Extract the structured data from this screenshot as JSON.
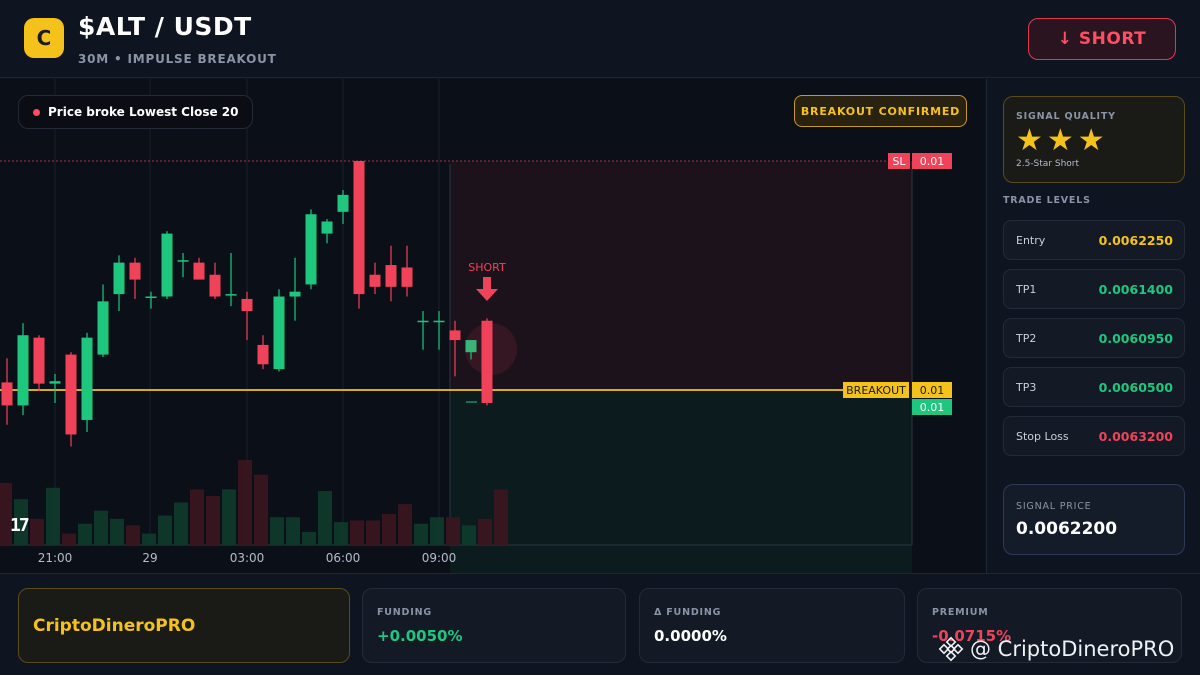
{
  "header": {
    "logo_letter": "C",
    "pair": "$ALT / USDT",
    "subtitle": "30M • IMPULSE BREAKOUT",
    "direction_button": "↓ SHORT"
  },
  "chart": {
    "signal_pill": "Price broke Lowest Close 20",
    "confirm_badge": "BREAKOUT CONFIRMED",
    "tv_logo": "17",
    "colors": {
      "up": "#1fc77e",
      "down": "#f0435a",
      "breakout": "#f5c21b"
    }
  },
  "chart_data": {
    "type": "candlestick",
    "x_ticks": [
      "21:00",
      "29",
      "03:00",
      "06:00",
      "09:00"
    ],
    "candles": [
      {
        "o": 0.0062285,
        "h": 0.0062385,
        "l": 0.006211,
        "c": 0.006219
      },
      {
        "o": 0.006219,
        "h": 0.006253,
        "l": 0.006215,
        "c": 0.006248
      },
      {
        "o": 0.006247,
        "h": 0.006248,
        "l": 0.006225,
        "c": 0.006228
      },
      {
        "o": 0.006228,
        "h": 0.006232,
        "l": 0.00622,
        "c": 0.006229
      },
      {
        "o": 0.00624,
        "h": 0.006241,
        "l": 0.006202,
        "c": 0.006207
      },
      {
        "o": 0.006213,
        "h": 0.006249,
        "l": 0.006208,
        "c": 0.006247
      },
      {
        "o": 0.00624,
        "h": 0.006269,
        "l": 0.006239,
        "c": 0.006262
      },
      {
        "o": 0.006265,
        "h": 0.006281,
        "l": 0.006258,
        "c": 0.006278
      },
      {
        "o": 0.006278,
        "h": 0.00628,
        "l": 0.006263,
        "c": 0.006271
      },
      {
        "o": 0.006264,
        "h": 0.006266,
        "l": 0.006259,
        "c": 0.006264
      },
      {
        "o": 0.006264,
        "h": 0.006291,
        "l": 0.006263,
        "c": 0.00629
      },
      {
        "o": 0.006279,
        "h": 0.006282,
        "l": 0.006272,
        "c": 0.006279
      },
      {
        "o": 0.006278,
        "h": 0.00628,
        "l": 0.006273,
        "c": 0.006271
      },
      {
        "o": 0.006273,
        "h": 0.006278,
        "l": 0.006263,
        "c": 0.006264
      },
      {
        "o": 0.006265,
        "h": 0.006282,
        "l": 0.00626,
        "c": 0.006265
      },
      {
        "o": 0.006263,
        "h": 0.006266,
        "l": 0.006246,
        "c": 0.006258
      },
      {
        "o": 0.006244,
        "h": 0.006248,
        "l": 0.006234,
        "c": 0.006236
      },
      {
        "o": 0.006234,
        "h": 0.006267,
        "l": 0.006233,
        "c": 0.006264
      },
      {
        "o": 0.006264,
        "h": 0.00628,
        "l": 0.006254,
        "c": 0.006266
      },
      {
        "o": 0.006269,
        "h": 0.0063,
        "l": 0.006267,
        "c": 0.006298
      },
      {
        "o": 0.00629,
        "h": 0.006296,
        "l": 0.006286,
        "c": 0.006295
      },
      {
        "o": 0.006299,
        "h": 0.006308,
        "l": 0.006294,
        "c": 0.006306
      },
      {
        "o": 0.00632,
        "h": 0.00632,
        "l": 0.006259,
        "c": 0.006265
      },
      {
        "o": 0.006273,
        "h": 0.006278,
        "l": 0.006265,
        "c": 0.006268
      },
      {
        "o": 0.006277,
        "h": 0.006285,
        "l": 0.006262,
        "c": 0.006268
      },
      {
        "o": 0.006276,
        "h": 0.006285,
        "l": 0.006264,
        "c": 0.006268
      },
      {
        "o": 0.006254,
        "h": 0.006258,
        "l": 0.006242,
        "c": 0.006254
      },
      {
        "o": 0.006254,
        "h": 0.006258,
        "l": 0.006242,
        "c": 0.006254
      },
      {
        "o": 0.00625,
        "h": 0.006254,
        "l": 0.006231,
        "c": 0.006246
      },
      {
        "o": 0.006241,
        "h": 0.006244,
        "l": 0.006238,
        "c": 0.006246
      },
      {
        "o": 0.006254,
        "h": 0.006255,
        "l": 0.006219,
        "c": 0.00622
      }
    ],
    "volume": [
      38,
      28,
      16,
      35,
      7,
      13,
      21,
      16,
      12,
      7,
      18,
      26,
      34,
      30,
      34,
      52,
      43,
      17,
      17,
      8,
      33,
      14,
      15,
      15,
      19,
      25,
      13,
      17,
      17,
      12,
      16,
      34
    ],
    "levels": {
      "stop_loss": {
        "label": "SL",
        "value": "0.01"
      },
      "breakout": {
        "label": "BREAKOUT",
        "value": "0.01"
      },
      "current": {
        "value": "0.01"
      }
    },
    "annotation": "SHORT"
  },
  "right_panel": {
    "quality_label": "SIGNAL QUALITY",
    "stars": "★★★",
    "quality_sub": "2.5-Star Short",
    "levels_title": "TRADE LEVELS",
    "levels": [
      {
        "name": "Entry",
        "value": "0.0062250",
        "color": "#f5c21b"
      },
      {
        "name": "TP1",
        "value": "0.0061400",
        "color": "#1fc77e"
      },
      {
        "name": "TP2",
        "value": "0.0060950",
        "color": "#1fc77e"
      },
      {
        "name": "TP3",
        "value": "0.0060500",
        "color": "#1fc77e"
      },
      {
        "name": "Stop Loss",
        "value": "0.0063200",
        "color": "#f0435a"
      }
    ],
    "signal_price_label": "SIGNAL PRICE",
    "signal_price": "0.0062200"
  },
  "bottom": {
    "brand": "CriptoDineroPRO",
    "stats": [
      {
        "label": "FUNDING",
        "value": "+0.0050%",
        "color": "#1fc77e"
      },
      {
        "label": "Δ FUNDING",
        "value": "0.0000%",
        "color": "#ffffff"
      },
      {
        "label": "PREMIUM",
        "value": "-0.0715%",
        "color": "#f0435a"
      }
    ],
    "watermark": "@ CriptoDineroPRO"
  }
}
